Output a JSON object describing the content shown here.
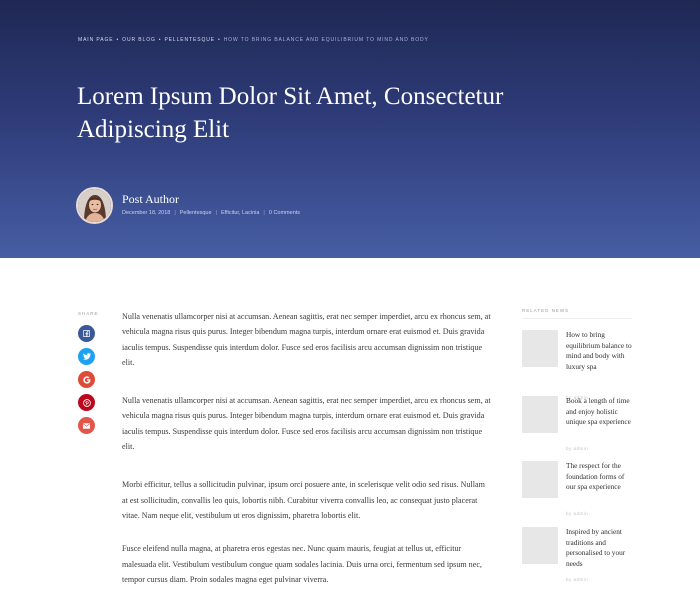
{
  "breadcrumb": {
    "items": [
      "Main page",
      "Our blog",
      "Pellentesque"
    ],
    "separator": "•",
    "current": "How to bring balance and equilibrium to mind and body"
  },
  "post": {
    "title": "Lorem Ipsum Dolor Sit Amet, Consectetur Adipiscing Elit",
    "author": "Post Author",
    "date": "December 18, 2018",
    "category": "Pellentesque",
    "tags": "Efficitur, Lacinia",
    "comments": "0 Comments",
    "meta_separator": "|"
  },
  "share": {
    "label": "Share",
    "buttons": [
      {
        "name": "facebook",
        "icon": "facebook-icon",
        "color": "#3b5998"
      },
      {
        "name": "twitter",
        "icon": "twitter-icon",
        "color": "#1da1f2"
      },
      {
        "name": "google",
        "icon": "google-icon",
        "color": "#dd4b39"
      },
      {
        "name": "pinterest",
        "icon": "pinterest-icon",
        "color": "#bd081c"
      },
      {
        "name": "email",
        "icon": "email-icon",
        "color": "#e2574c"
      }
    ]
  },
  "article": {
    "paragraphs": [
      "Nulla venenatis ullamcorper nisi at accumsan. Aenean sagittis, erat nec semper imperdiet, arcu ex rhoncus sem, at vehicula magna risus quis purus. Integer bibendum magna turpis, interdum ornare erat euismod et. Duis gravida iaculis tempus. Suspendisse quis interdum dolor. Fusce sed eros facilisis arcu accumsan dignissim non tristique elit.",
      "Nulla venenatis ullamcorper nisi at accumsan. Aenean sagittis, erat nec semper imperdiet, arcu ex rhoncus sem, at vehicula magna risus quis purus. Integer bibendum magna turpis, interdum ornare erat euismod et. Duis gravida iaculis tempus. Suspendisse quis interdum dolor. Fusce sed eros facilisis arcu accumsan dignissim non tristique elit.",
      "Morbi efficitur, tellus a sollicitudin pulvinar, ipsum orci posuere ante, in scelerisque velit odio sed risus. Nullam at est sollicitudin, convallis leo quis, lobortis nibh. Curabitur viverra convallis leo, ac consequat justo placerat vitae. Nam neque elit, vestibulum ut eros dignissim, pharetra lobortis elit.",
      "Fusce eleifend nulla magna, at pharetra eros egestas nec. Nunc quam mauris, feugiat at tellus ut, efficitur malesuada elit. Vestibulum vestibulum congue quam sodales lacinia. Duis urna orci, fermentum sed ipsum nec, tempor cursus diam. Proin sodales magna eget pulvinar viverra."
    ]
  },
  "sidebar": {
    "label": "Related News",
    "items": [
      {
        "title": "How to bring equilibrium balance to mind and body with luxury spa",
        "by": "by admin"
      },
      {
        "title": "Book a length of time and enjoy holistic unique spa experience",
        "by": "by admin"
      },
      {
        "title": "The respect for the foundation forms of our spa experience",
        "by": "by admin"
      },
      {
        "title": "Inspired by ancient traditions and personalised to your needs",
        "by": "by admin"
      }
    ]
  },
  "colors": {
    "hero_top": "#1f2854",
    "hero_bottom": "#465ea4",
    "thumb_placeholder": "#e7e7e7"
  }
}
